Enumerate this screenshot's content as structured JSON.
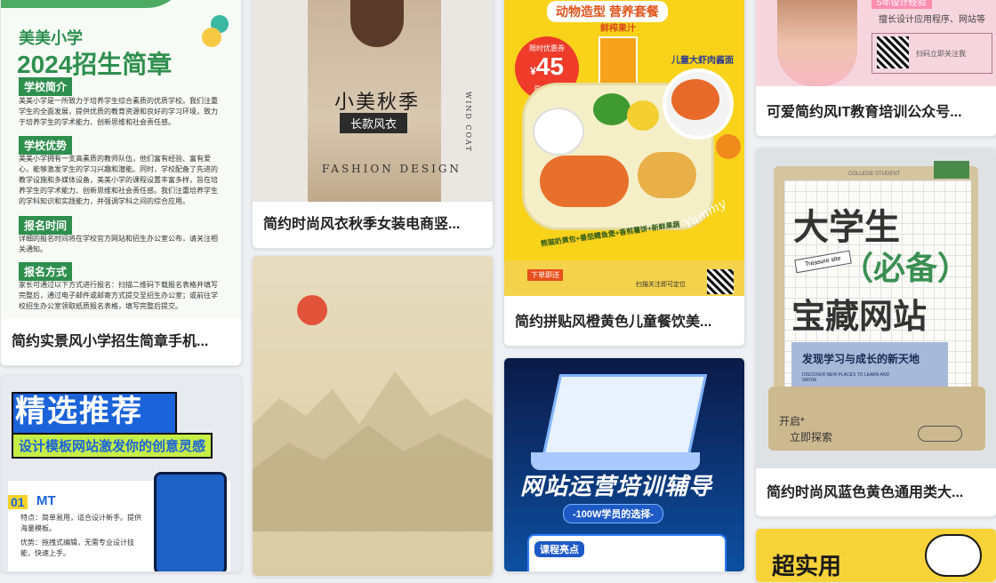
{
  "cards": [
    {
      "title": "简约实景风小学招生简章手机...",
      "poster": {
        "school_name": "美美小学",
        "headline": "2024招生简章",
        "sections": [
          {
            "heading": "学校简介",
            "body": "美美小学是一所致力于培养学生综合素质的优质学校。我们注重学生的全面发展，提供优质的教育资源和良好的学习环境，致力于培养学生的学术能力、创新思维和社会责任感。"
          },
          {
            "heading": "学校优势",
            "body": "美美小学拥有一支高素质的教师队伍，他们富有经验、富有爱心，能够激发学生的学习兴趣和潜能。同时，学校配备了先进的教学设施和多媒体设备，美美小学的课程设置丰富多样，旨在培养学生的学术能力、创新思维和社会责任感。我们注重培养学生的学科知识和实践能力，并强调学科之间的综合应用。"
          },
          {
            "heading": "报名时间",
            "body": "详细的报名时间将在学校官方网站和招生办公室公布，请关注相关通知。"
          },
          {
            "heading": "报名方式",
            "body": "家长可通过以下方式进行报名：扫描二维码下载报名表格并填写完整后，通过电子邮件或邮寄方式提交至招生办公室；或前往学校招生办公室领取纸质报名表格，填写完整后提交。"
          }
        ]
      }
    },
    {
      "title": "简约时尚风衣秋季女装电商竖...",
      "poster": {
        "line1": "小美秋季",
        "line2": "长款风衣",
        "footer": "FASHION DESIGN",
        "side": "WIND COAT"
      }
    },
    {
      "title": "简约拼贴风橙黄色儿童餐饮美...",
      "poster": {
        "top": "动物造型 营养套餐",
        "badge_label": "限时优惠券",
        "price_symbol": "¥",
        "price": "45",
        "old_price": "原价￥58",
        "drink": "鲜榨果汁",
        "dish": "儿童大虾肉酱面",
        "bottom": "熊猫奶黄包+番茄鳕鱼堡+香煎薯饼+新鲜果蔬",
        "script": "Yummy",
        "order": "下单即送",
        "qr_note": "扫描关注即可定位"
      }
    },
    {
      "title": "",
      "poster": {}
    },
    {
      "title": "",
      "poster": {
        "headline": "网站运营培训辅导",
        "sub": "-100W学员的选择-",
        "tag": "课程亮点"
      }
    },
    {
      "title": "可爱简约风IT教育培训公众号...",
      "poster": {
        "badge": "5年设计经验",
        "desc": "擅长设计应用程序、网站等",
        "qr_text": "扫码立即关注我"
      }
    },
    {
      "title": "简约时尚风蓝色黄色通用类大...",
      "poster": {
        "folder_tab": "COLLEGE STUDENT",
        "line1": "大学生",
        "line2": "（必备）",
        "line3": "宝藏网站",
        "ticket": "Treasure site",
        "subtitle": "发现学习与成长的新天地",
        "eng": "DISCOVER NEW PLACES TO LEARN AND GROW",
        "start": "开启*",
        "explore": "立即探索"
      }
    },
    {
      "title": "",
      "poster": {
        "headline": "精选推荐",
        "sub": "设计模板网站激发你的创意灵感",
        "num": "01",
        "name": "MT",
        "feature": "特点：简单易用，适合设计新手。提供海量模板。",
        "advantage": "优势：拖拽式编辑，无需专业设计技能，快速上手。"
      }
    },
    {
      "title": "",
      "poster": {
        "peek": "超实用"
      }
    }
  ],
  "colors": {
    "green": "#2f8f4e",
    "yellow": "#f9d21a",
    "blue": "#1b63d9",
    "page_bg": "#eef0f3"
  }
}
